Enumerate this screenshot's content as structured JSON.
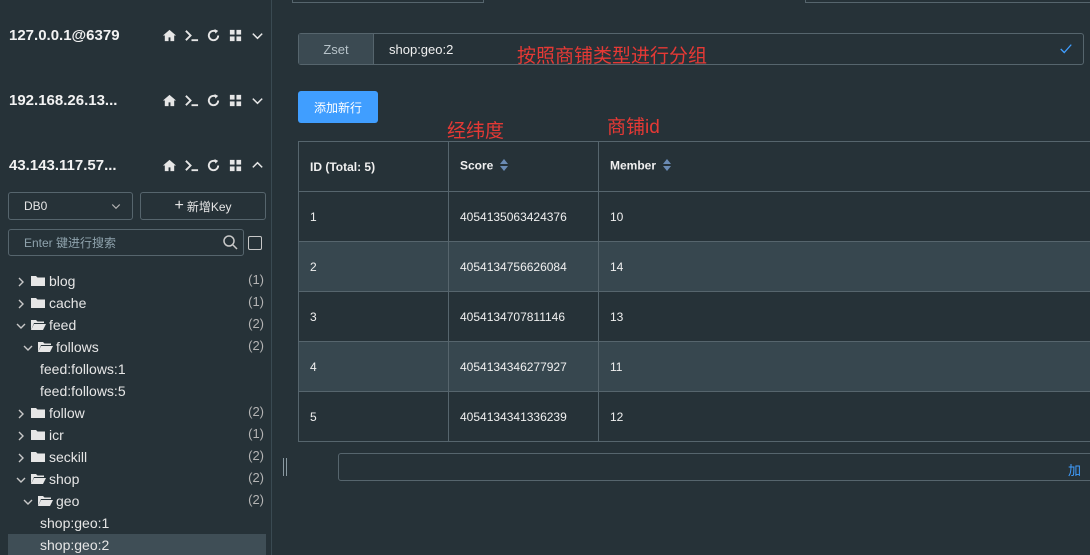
{
  "connections": [
    {
      "name": "127.0.0.1@6379",
      "expanded": false
    },
    {
      "name": "192.168.26.13...",
      "expanded": false
    },
    {
      "name": "43.143.117.57...",
      "expanded": true
    }
  ],
  "db_select": {
    "value": "DB0"
  },
  "add_key": {
    "label": "新增Key",
    "plus": "+"
  },
  "search": {
    "placeholder": "Enter 键进行搜索"
  },
  "tree": [
    {
      "label": "blog",
      "count": "(1)",
      "type": "folder",
      "expanded": false
    },
    {
      "label": "cache",
      "count": "(1)",
      "type": "folder",
      "expanded": false
    },
    {
      "label": "feed",
      "count": "(2)",
      "type": "folder",
      "expanded": true
    },
    {
      "label": "follows",
      "count": "(2)",
      "type": "folder",
      "expanded": true
    },
    {
      "label": "feed:follows:1",
      "count": "",
      "type": "key"
    },
    {
      "label": "feed:follows:5",
      "count": "",
      "type": "key"
    },
    {
      "label": "follow",
      "count": "(2)",
      "type": "folder",
      "expanded": false
    },
    {
      "label": "icr",
      "count": "(1)",
      "type": "folder",
      "expanded": false
    },
    {
      "label": "seckill",
      "count": "(2)",
      "type": "folder",
      "expanded": false
    },
    {
      "label": "shop",
      "count": "(2)",
      "type": "folder",
      "expanded": true
    },
    {
      "label": "geo",
      "count": "(2)",
      "type": "folder",
      "expanded": true
    },
    {
      "label": "shop:geo:1",
      "count": "",
      "type": "key"
    },
    {
      "label": "shop:geo:2",
      "count": "",
      "type": "key",
      "selected": true
    }
  ],
  "key": {
    "type": "Zset",
    "name": "shop:geo:2"
  },
  "annotations": {
    "group": "按照商铺类型进行分组",
    "lnglat": "经纬度",
    "shop_id": "商铺id"
  },
  "add_row": {
    "label": "添加新行"
  },
  "table": {
    "headers": {
      "id": "ID (Total: 5)",
      "score": "Score",
      "member": "Member"
    },
    "rows": [
      {
        "id": "1",
        "score": "4054135063424376",
        "member": "10"
      },
      {
        "id": "2",
        "score": "4054134756626084",
        "member": "14"
      },
      {
        "id": "3",
        "score": "4054134707811146",
        "member": "13"
      },
      {
        "id": "4",
        "score": "4054134346277927",
        "member": "11"
      },
      {
        "id": "5",
        "score": "4054134341336239",
        "member": "12"
      }
    ]
  },
  "bottom_link": {
    "label": "加"
  },
  "colors": {
    "accent": "#409eff",
    "annotation": "#e53935",
    "background": "#263238"
  }
}
